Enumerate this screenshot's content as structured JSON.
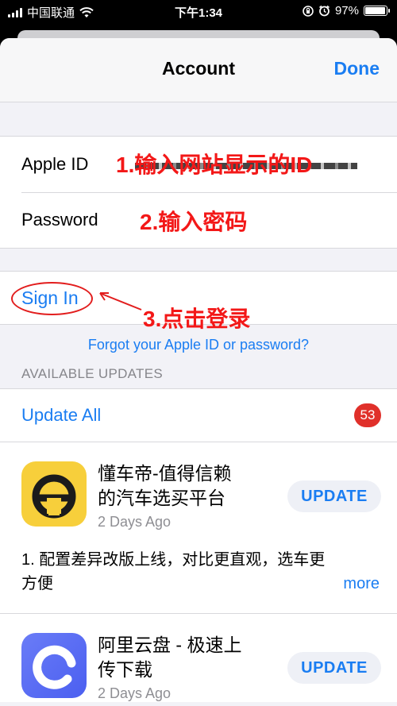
{
  "status": {
    "carrier": "中国联通",
    "time": "下午1:34",
    "battery": "97%",
    "battery_level": 0.97
  },
  "sheet": {
    "title": "Account",
    "done_label": "Done"
  },
  "form": {
    "apple_id_label": "Apple ID",
    "password_label": "Password",
    "apple_id_annotation": "1.输入网站显示的ID",
    "password_annotation": "2.输入密码",
    "sign_in_label": "Sign In",
    "sign_in_annotation": "3.点击登录",
    "forgot_label": "Forgot your Apple ID or password?"
  },
  "updates": {
    "section_title": "AVAILABLE UPDATES",
    "update_all_label": "Update All",
    "badge_count": "53",
    "apps": [
      {
        "name_line1": "懂车帝-值得信赖",
        "name_line2": "的汽车选买平台",
        "age": "2 Days Ago",
        "button": "UPDATE",
        "desc_line1": "1. 配置差异改版上线，对比更直观，选车更",
        "desc_line2": "方便",
        "more": "more",
        "icon": "dongchedi-steering-icon",
        "icon_color": "#f7cf3b"
      },
      {
        "name_line1": "阿里云盘 - 极速上",
        "name_line2": "传下载",
        "age": "2 Days Ago",
        "button": "UPDATE",
        "icon": "aliyun-drive-icon",
        "icon_color": "#5b6df5"
      }
    ]
  },
  "colors": {
    "accent": "#1a7df2",
    "annotation": "#f31818",
    "badge": "#e0302a"
  }
}
